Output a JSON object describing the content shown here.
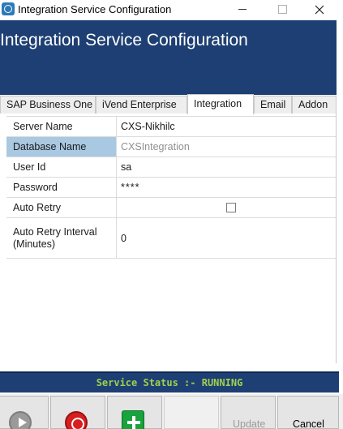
{
  "window": {
    "title": "Integration Service Configuration"
  },
  "header": {
    "title": "Integration Service Configuration"
  },
  "tabs": [
    {
      "label": "SAP Business One",
      "active": false
    },
    {
      "label": "iVend Enterprise",
      "active": false
    },
    {
      "label": "Integration",
      "active": true
    },
    {
      "label": "Email",
      "active": false
    },
    {
      "label": "Addon",
      "active": false
    }
  ],
  "properties": [
    {
      "name": "Server Name",
      "value": "CXS-Nikhilc"
    },
    {
      "name": "Database Name",
      "value": "CXSIntegration",
      "selected": true
    },
    {
      "name": "User Id",
      "value": "sa"
    },
    {
      "name": "Password",
      "value": "****"
    },
    {
      "name": "Auto Retry",
      "value": "",
      "checked": false
    },
    {
      "name": "Auto Retry Interval (Minutes)",
      "value": "0"
    }
  ],
  "status": {
    "text": "Service Status :- RUNNING"
  },
  "toolbar": {
    "start_icon": "play-icon",
    "stop_icon": "stop-icon",
    "add_icon": "plus-icon",
    "update_label": "Update",
    "update_enabled": false,
    "cancel_label": "Cancel"
  },
  "colors": {
    "header_bg": "#1e3f73",
    "status_text": "#9fd14d",
    "selected_row": "#a9c8e2"
  }
}
